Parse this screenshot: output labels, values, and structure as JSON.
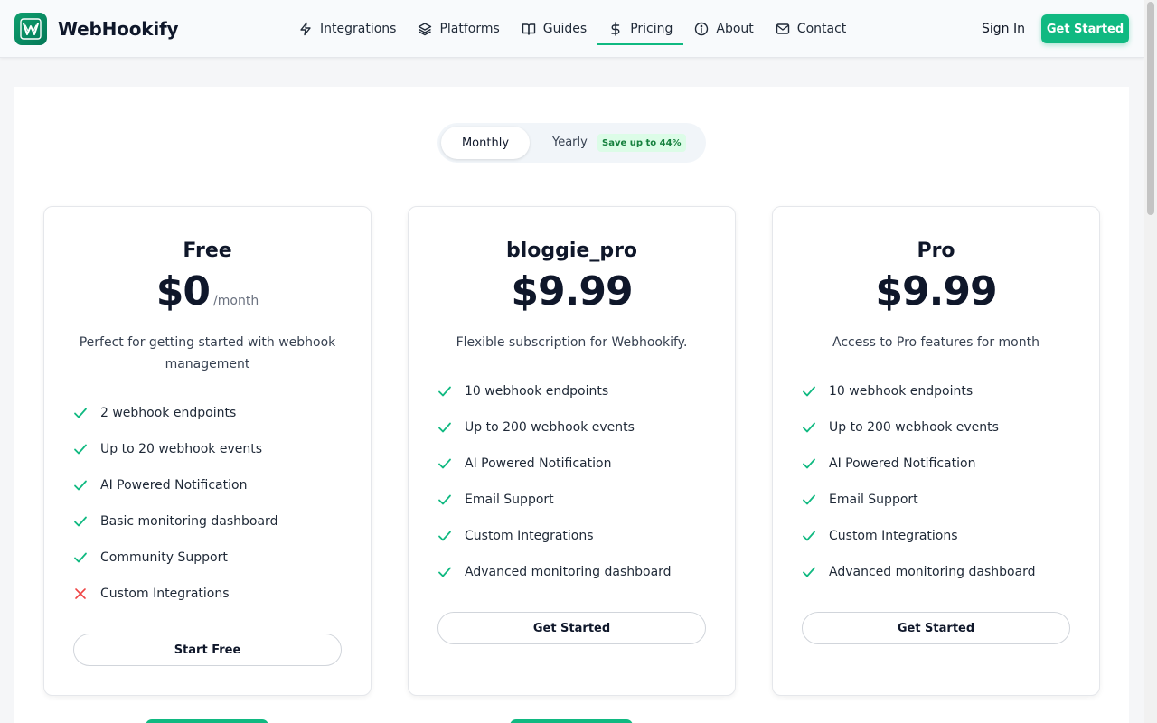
{
  "brand": {
    "name": "WebHookify"
  },
  "nav": [
    {
      "label": "Integrations",
      "icon": "lightning-icon"
    },
    {
      "label": "Platforms",
      "icon": "layers-icon"
    },
    {
      "label": "Guides",
      "icon": "book-icon"
    },
    {
      "label": "Pricing",
      "icon": "dollar-icon",
      "active": true
    },
    {
      "label": "About",
      "icon": "info-icon"
    },
    {
      "label": "Contact",
      "icon": "mail-icon"
    }
  ],
  "auth": {
    "sign_in": "Sign In",
    "get_started": "Get Started"
  },
  "billing_toggle": {
    "monthly": "Monthly",
    "yearly": "Yearly",
    "save_badge": "Save up to 44%"
  },
  "plans": [
    {
      "name": "Free",
      "price": "$0",
      "per": "/month",
      "description": "Perfect for getting started with webhook management",
      "features": [
        {
          "text": "2 webhook endpoints",
          "included": true
        },
        {
          "text": "Up to 20 webhook events",
          "included": true
        },
        {
          "text": "AI Powered Notification",
          "included": true
        },
        {
          "text": "Basic monitoring dashboard",
          "included": true
        },
        {
          "text": "Community Support",
          "included": true
        },
        {
          "text": "Custom Integrations",
          "included": false
        }
      ],
      "button": "Start Free"
    },
    {
      "name": "bloggie_pro",
      "price": "$9.99",
      "per": "",
      "description": "Flexible subscription for Webhookify.",
      "features": [
        {
          "text": "10 webhook endpoints",
          "included": true
        },
        {
          "text": "Up to 200 webhook events",
          "included": true
        },
        {
          "text": "AI Powered Notification",
          "included": true
        },
        {
          "text": "Email Support",
          "included": true
        },
        {
          "text": "Custom Integrations",
          "included": true
        },
        {
          "text": "Advanced monitoring dashboard",
          "included": true
        }
      ],
      "button": "Get Started"
    },
    {
      "name": "Pro",
      "price": "$9.99",
      "per": "",
      "description": "Access to Pro features for month",
      "features": [
        {
          "text": "10 webhook endpoints",
          "included": true
        },
        {
          "text": "Up to 200 webhook events",
          "included": true
        },
        {
          "text": "AI Powered Notification",
          "included": true
        },
        {
          "text": "Email Support",
          "included": true
        },
        {
          "text": "Custom Integrations",
          "included": true
        },
        {
          "text": "Advanced monitoring dashboard",
          "included": true
        }
      ],
      "button": "Get Started"
    }
  ],
  "colors": {
    "accent": "#10b981",
    "check": "#10b981",
    "cross": "#ef4444"
  }
}
